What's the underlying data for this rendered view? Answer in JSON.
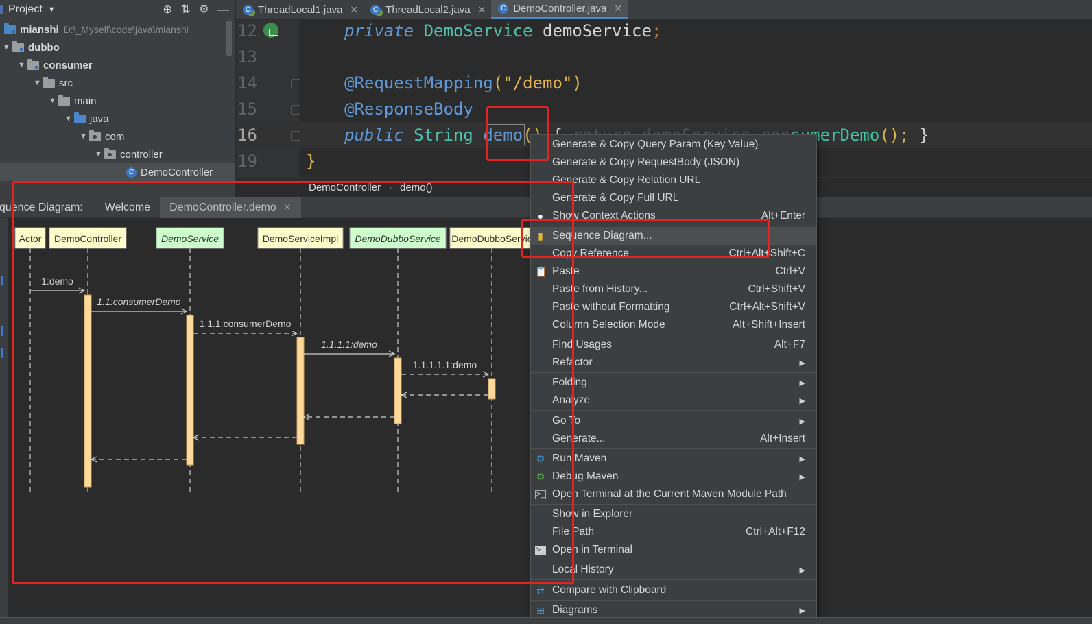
{
  "project_panel": {
    "title": "Project",
    "tree": [
      {
        "label": "mianshi",
        "path": "D:\\_Myself\\code\\java\\mianshi"
      },
      {
        "label": "dubbo"
      },
      {
        "label": "consumer"
      },
      {
        "label": "src"
      },
      {
        "label": "main"
      },
      {
        "label": "java"
      },
      {
        "label": "com"
      },
      {
        "label": "controller"
      },
      {
        "label": "DemoController"
      }
    ]
  },
  "editor_tabs": [
    {
      "label": "ThreadLocal1.java"
    },
    {
      "label": "ThreadLocal2.java"
    },
    {
      "label": "DemoController.java"
    }
  ],
  "editor": {
    "line_numbers": [
      "12",
      "13",
      "14",
      "15",
      "16",
      "19"
    ],
    "line12": {
      "kw": "private",
      "type": "DemoService",
      "name": "demoService",
      "semi": ";"
    },
    "line14": {
      "anno": "@RequestMapping",
      "open": "(",
      "str": "\"/demo\"",
      "close": ")"
    },
    "line15": {
      "anno": "@ResponseBody"
    },
    "line16": {
      "kw": "public",
      "type": "String",
      "method": "demo",
      "parens": "()",
      "brace_open": "{",
      "hidden": "return demoService.con",
      "call": "sumerDemo",
      "call_end": "();",
      "brace_close": "}"
    },
    "line19": {
      "brace": "}"
    }
  },
  "breadcrumb": {
    "class": "DemoController",
    "method": "demo()"
  },
  "sequence_panel": {
    "label": "equence Diagram:",
    "tabs": [
      {
        "label": "Welcome"
      },
      {
        "label": "DemoController.demo"
      }
    ]
  },
  "sequence_diagram": {
    "participants": [
      {
        "name": "Actor",
        "style": "plain"
      },
      {
        "name": "DemoController",
        "style": "plain"
      },
      {
        "name": "DemoService",
        "style": "interface"
      },
      {
        "name": "DemoServiceImpl",
        "style": "plain"
      },
      {
        "name": "DemoDubboService",
        "style": "interface"
      },
      {
        "name": "DemoDubboServic",
        "style": "plain"
      }
    ],
    "messages": [
      {
        "label": "1:demo",
        "from": 0,
        "to": 1,
        "italic": false
      },
      {
        "label": "1.1:consumerDemo",
        "from": 1,
        "to": 2,
        "italic": true
      },
      {
        "label": "1.1.1:consumerDemo",
        "from": 2,
        "to": 3,
        "italic": false
      },
      {
        "label": "1.1.1.1:demo",
        "from": 3,
        "to": 4,
        "italic": true
      },
      {
        "label": "1.1.1.1.1:demo",
        "from": 4,
        "to": 5,
        "italic": false
      }
    ]
  },
  "context_menu": {
    "items": [
      {
        "label": "Generate & Copy Query Param (Key Value)"
      },
      {
        "label": "Generate & Copy RequestBody (JSON)"
      },
      {
        "label": "Generate & Copy Relation URL"
      },
      {
        "label": "Generate & Copy Full URL"
      },
      {
        "label": "Show Context Actions",
        "shortcut": "Alt+Enter"
      },
      {
        "label": "Sequence Diagram..."
      },
      {
        "label": "Copy Reference",
        "shortcut": "Ctrl+Alt+Shift+C"
      },
      {
        "label": "Paste",
        "shortcut": "Ctrl+V"
      },
      {
        "label": "Paste from History...",
        "shortcut": "Ctrl+Shift+V"
      },
      {
        "label": "Paste without Formatting",
        "shortcut": "Ctrl+Alt+Shift+V"
      },
      {
        "label": "Column Selection Mode",
        "shortcut": "Alt+Shift+Insert"
      },
      {
        "label": "Find Usages",
        "shortcut": "Alt+F7"
      },
      {
        "label": "Refactor"
      },
      {
        "label": "Folding"
      },
      {
        "label": "Analyze"
      },
      {
        "label": "Go To"
      },
      {
        "label": "Generate...",
        "shortcut": "Alt+Insert"
      },
      {
        "label": "Run Maven"
      },
      {
        "label": "Debug Maven"
      },
      {
        "label": "Open Terminal at the Current Maven Module Path"
      },
      {
        "label": "Show in Explorer"
      },
      {
        "label": "File Path",
        "shortcut": "Ctrl+Alt+F12"
      },
      {
        "label": "Open in Terminal"
      },
      {
        "label": "Local History"
      },
      {
        "label": "Compare with Clipboard"
      },
      {
        "label": "Diagrams"
      }
    ]
  },
  "colors": {
    "highlight_red": "#e5241f",
    "lifeline_box": "#ffffcc",
    "interface_box": "#ccffcc",
    "activation": "#ffd99a"
  }
}
